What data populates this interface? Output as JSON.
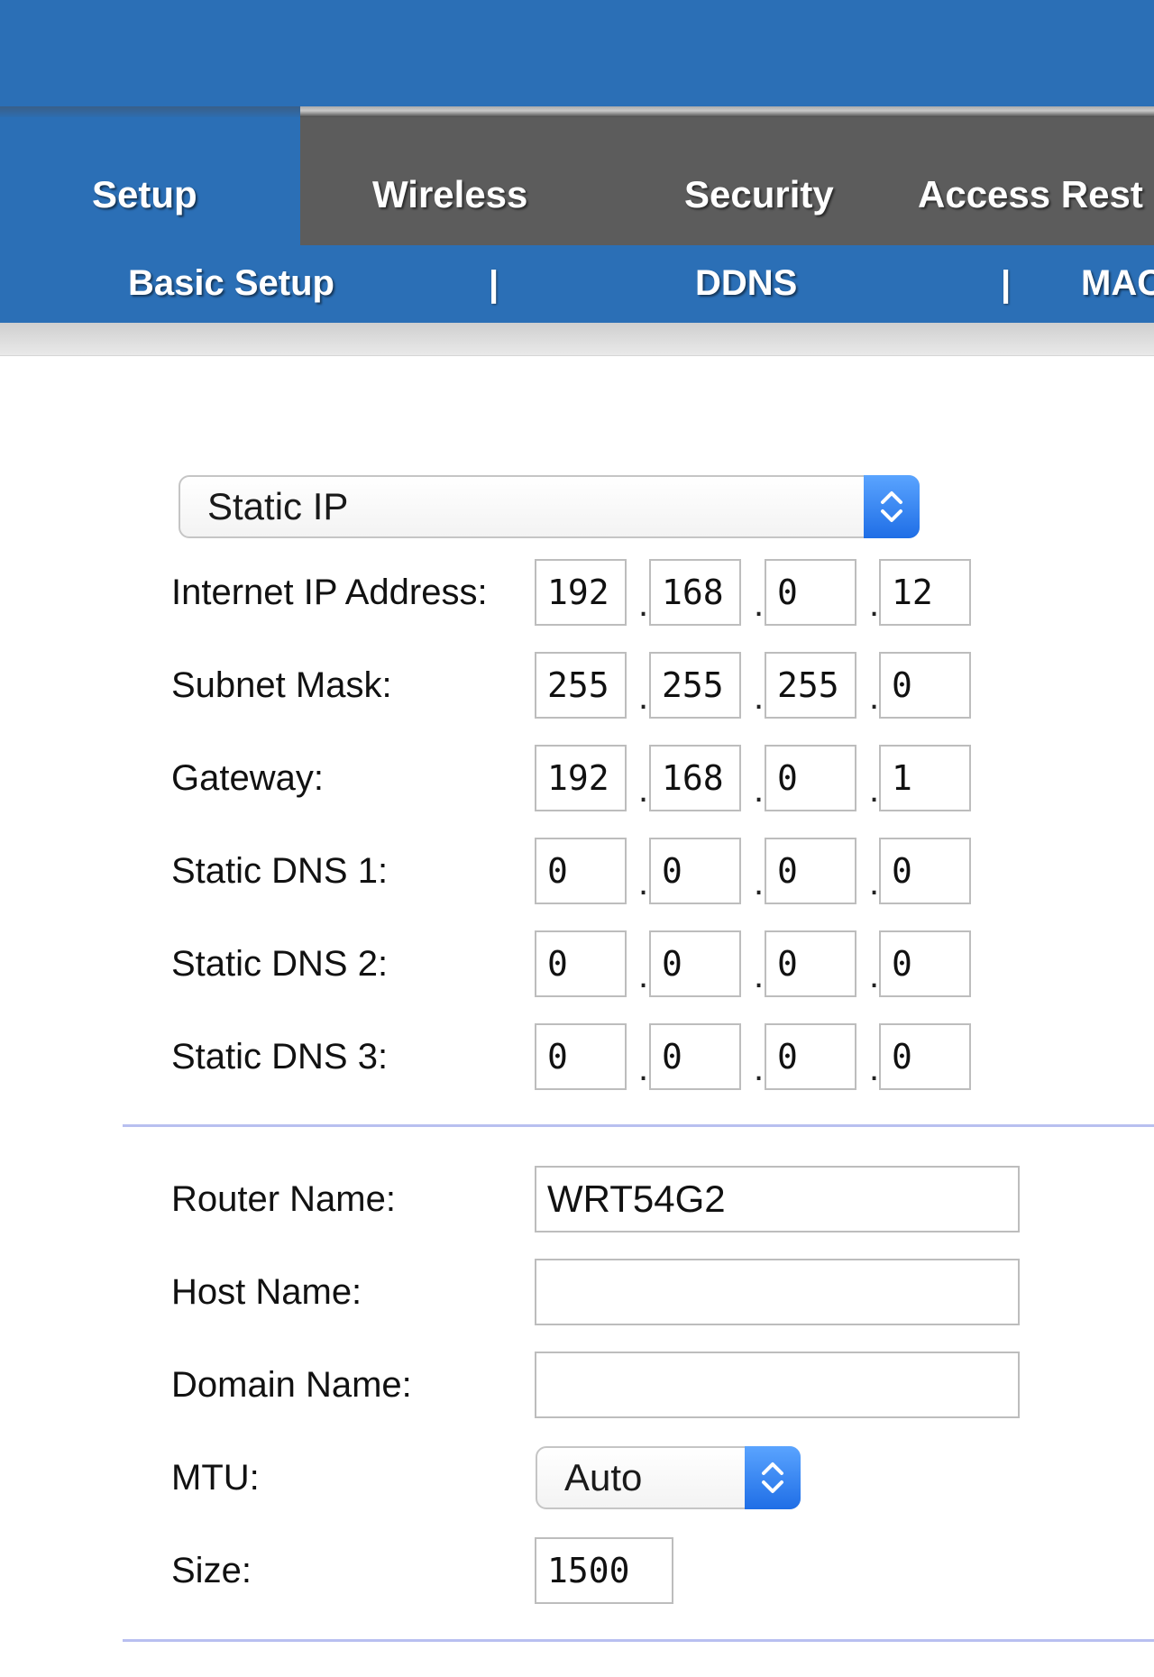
{
  "nav": {
    "tabs": [
      {
        "label": "Setup",
        "active": true
      },
      {
        "label": "Wireless",
        "active": false
      },
      {
        "label": "Security",
        "active": false
      },
      {
        "label": "Access Rest",
        "active": false
      }
    ],
    "subtabs": [
      "Basic Setup",
      "DDNS",
      "MAC"
    ],
    "separator": "|"
  },
  "connection_type": {
    "selected": "Static IP"
  },
  "ip_separator": ".",
  "static_ip": [
    {
      "label": "Internet IP Address:",
      "octets": [
        "192",
        "168",
        "0",
        "12"
      ]
    },
    {
      "label": "Subnet Mask:",
      "octets": [
        "255",
        "255",
        "255",
        "0"
      ]
    },
    {
      "label": "Gateway:",
      "octets": [
        "192",
        "168",
        "0",
        "1"
      ]
    },
    {
      "label": "Static DNS 1:",
      "octets": [
        "0",
        "0",
        "0",
        "0"
      ]
    },
    {
      "label": "Static DNS 2:",
      "octets": [
        "0",
        "0",
        "0",
        "0"
      ]
    },
    {
      "label": "Static DNS 3:",
      "octets": [
        "0",
        "0",
        "0",
        "0"
      ]
    }
  ],
  "optional": {
    "router_name": {
      "label": "Router Name:",
      "value": "WRT54G2"
    },
    "host_name": {
      "label": "Host Name:",
      "value": ""
    },
    "domain_name": {
      "label": "Domain Name:",
      "value": ""
    },
    "mtu": {
      "label": "MTU:",
      "selected": "Auto"
    },
    "size": {
      "label": "Size:",
      "value": "1500"
    }
  },
  "colors": {
    "brand_blue": "#2b6fb6",
    "tab_gray": "#5c5c5c",
    "select_accent": "#1f6ee6"
  }
}
